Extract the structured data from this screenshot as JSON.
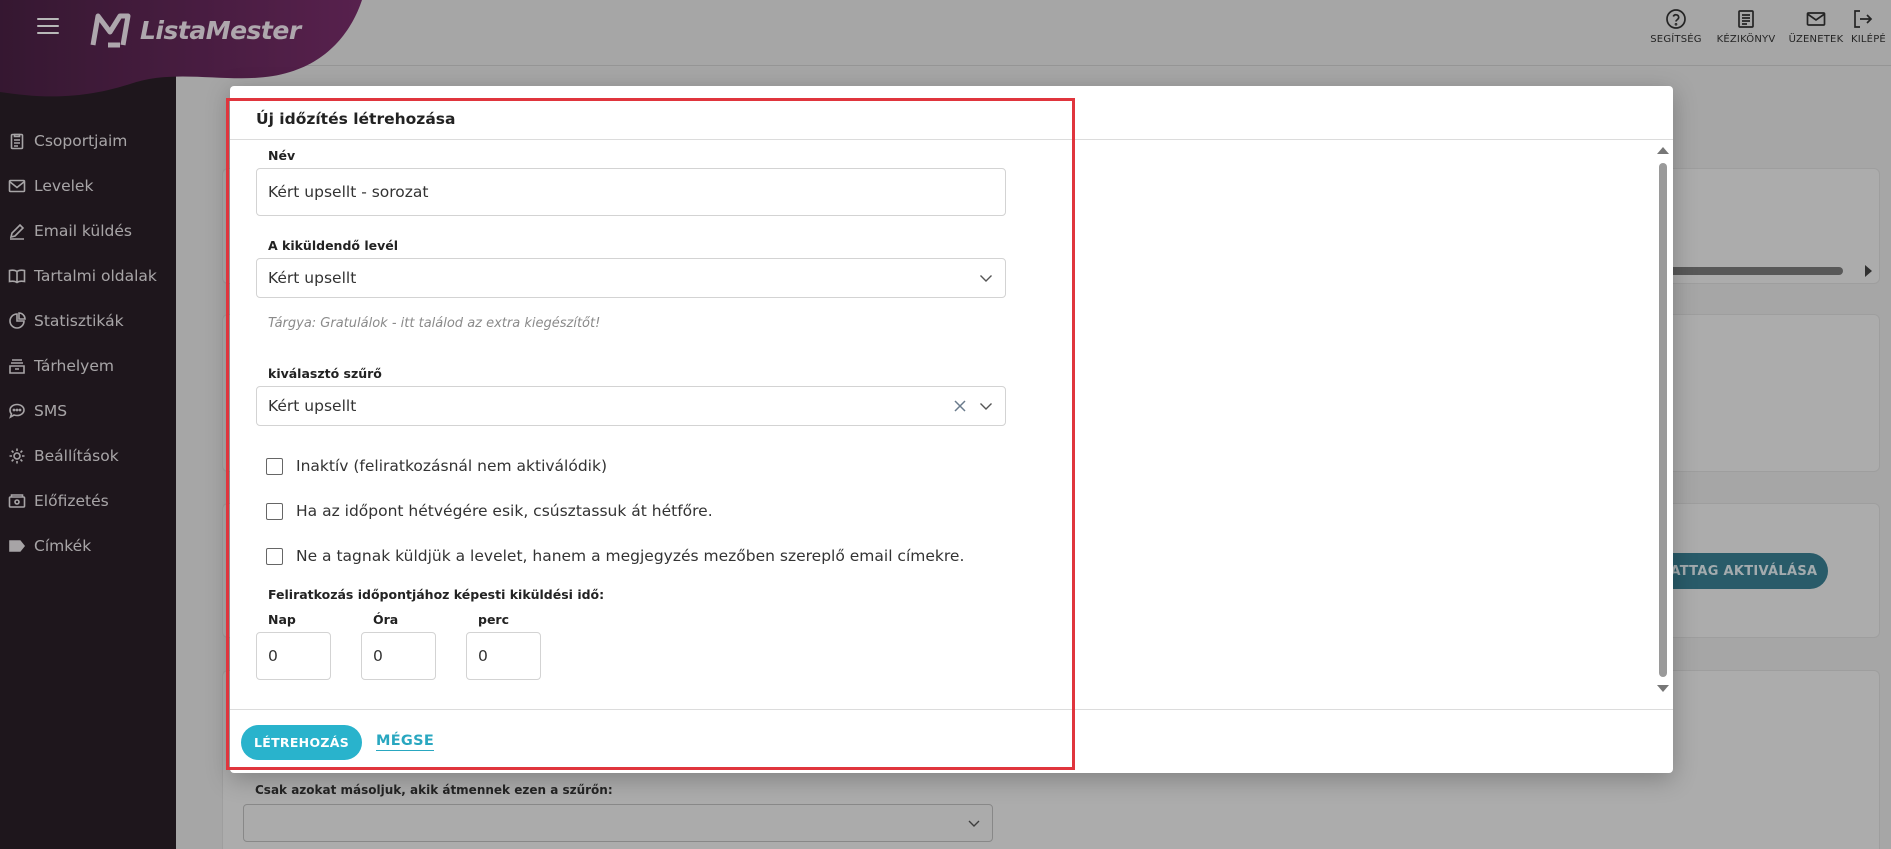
{
  "app": {
    "name": "ListaMester",
    "brand_color": "#6b2a5f",
    "accent_color": "#29b3cc",
    "highlight_color": "#e0353d"
  },
  "sidebar": {
    "items": [
      {
        "label": "Csoportjaim",
        "icon": "clipboard-icon"
      },
      {
        "label": "Levelek",
        "icon": "mail-icon"
      },
      {
        "label": "Email küldés",
        "icon": "pencil-icon"
      },
      {
        "label": "Tartalmi oldalak",
        "icon": "book-icon"
      },
      {
        "label": "Statisztikák",
        "icon": "pie-chart-icon"
      },
      {
        "label": "Tárhelyem",
        "icon": "archive-icon"
      },
      {
        "label": "SMS",
        "icon": "chat-icon"
      },
      {
        "label": "Beállítások",
        "icon": "gear-icon"
      },
      {
        "label": "Előfizetés",
        "icon": "wallet-icon"
      },
      {
        "label": "Címkék",
        "icon": "tag-icon"
      }
    ]
  },
  "header": {
    "actions": [
      {
        "label": "SEGÍTSÉG",
        "icon": "help-icon"
      },
      {
        "label": "KÉZIKÖNYV",
        "icon": "manual-icon"
      },
      {
        "label": "ÜZENETEK",
        "icon": "envelope-icon"
      },
      {
        "label": "KILÉPÉ",
        "icon": "logout-icon"
      }
    ]
  },
  "background": {
    "pill_label": "ZATTAG AKTIVÁLÁSA",
    "copy_filter_label": "Csak azokat másoljuk, akik átmennek ezen a szűrőn:"
  },
  "modal": {
    "title": "Új időzítés létrehozása",
    "name_label": "Név",
    "name_value": "Kért upsellt - sorozat",
    "letter_label": "A kiküldendő levél",
    "letter_value": "Kért upsellt",
    "letter_hint": "Tárgya: Gratulálok - itt találod az extra kiegészítőt!",
    "filter_label": "kiválasztó szűrő",
    "filter_value": "Kért upsellt",
    "checkboxes": [
      {
        "label": "Inaktív (feliratkozásnál nem aktiválódik)",
        "checked": false
      },
      {
        "label": "Ha az időpont hétvégére esik, csúsztassuk át hétfőre.",
        "checked": false
      },
      {
        "label": "Ne a tagnak küldjük a levelet, hanem a megjegyzés mezőben szereplő email címekre.",
        "checked": false
      }
    ],
    "offset_label": "Feliratkozás időpontjához képesti kiküldési idő:",
    "offset": {
      "day_label": "Nap",
      "day_value": "0",
      "hour_label": "Óra",
      "hour_value": "0",
      "minute_label": "perc",
      "minute_value": "0"
    },
    "create_button": "LÉTREHOZÁS",
    "cancel_button": "MÉGSE"
  }
}
